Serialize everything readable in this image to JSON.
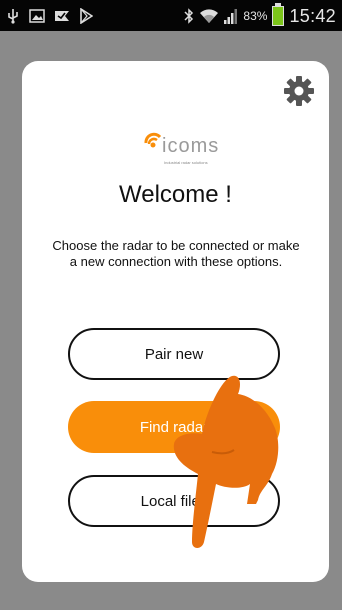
{
  "status_bar": {
    "icons_left": [
      "usb-icon",
      "image-icon",
      "checkmark-flag-icon",
      "play-store-icon"
    ],
    "icons_right": [
      "bluetooth-icon",
      "wifi-icon",
      "signal-icon",
      "battery-icon"
    ],
    "battery": "83%",
    "time": "15:42"
  },
  "dialog": {
    "settings_icon": "gear-icon",
    "logo": {
      "text": "icoms",
      "tagline": "Industrial radar solutions"
    },
    "title": "Welcome !",
    "description": "Choose the radar to be connected or make a new connection with these options.",
    "buttons": {
      "pair": "Pair new",
      "find": "Find radar",
      "local": "Local files"
    },
    "accent_color": "#f98e0a"
  },
  "overlay": {
    "icon": "pointing-hand-icon"
  }
}
